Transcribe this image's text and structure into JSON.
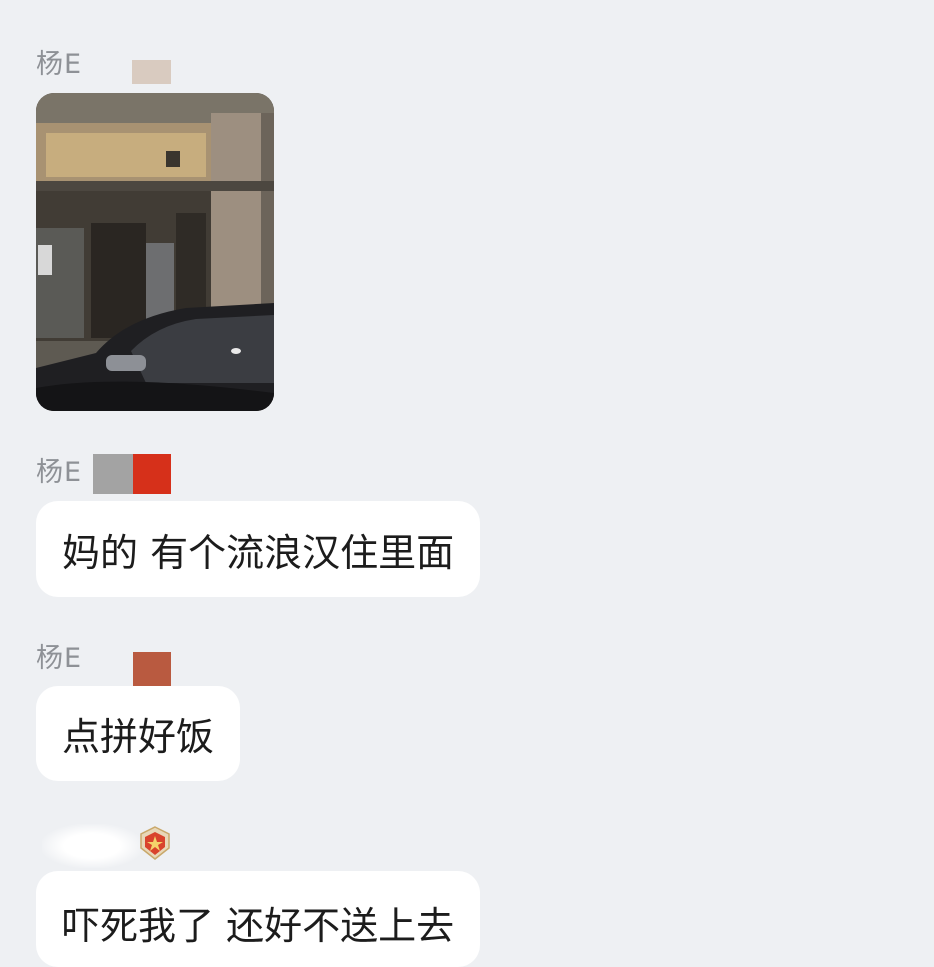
{
  "messages": [
    {
      "sender": "杨E",
      "type": "image",
      "image_desc_icon": "photo-of-building"
    },
    {
      "sender": "杨E",
      "type": "text",
      "text": "妈的 有个流浪汉住里面"
    },
    {
      "sender": "杨E",
      "type": "text",
      "text": "点拼好饭"
    },
    {
      "sender": "",
      "type": "text",
      "text": "吓死我了 还好不送上去"
    }
  ],
  "colors": {
    "background": "#eef0f3",
    "bubble": "#ffffff",
    "sender_name": "#8e9196",
    "text": "#1c1c1c"
  },
  "icons": {
    "badge": "badge-icon"
  }
}
